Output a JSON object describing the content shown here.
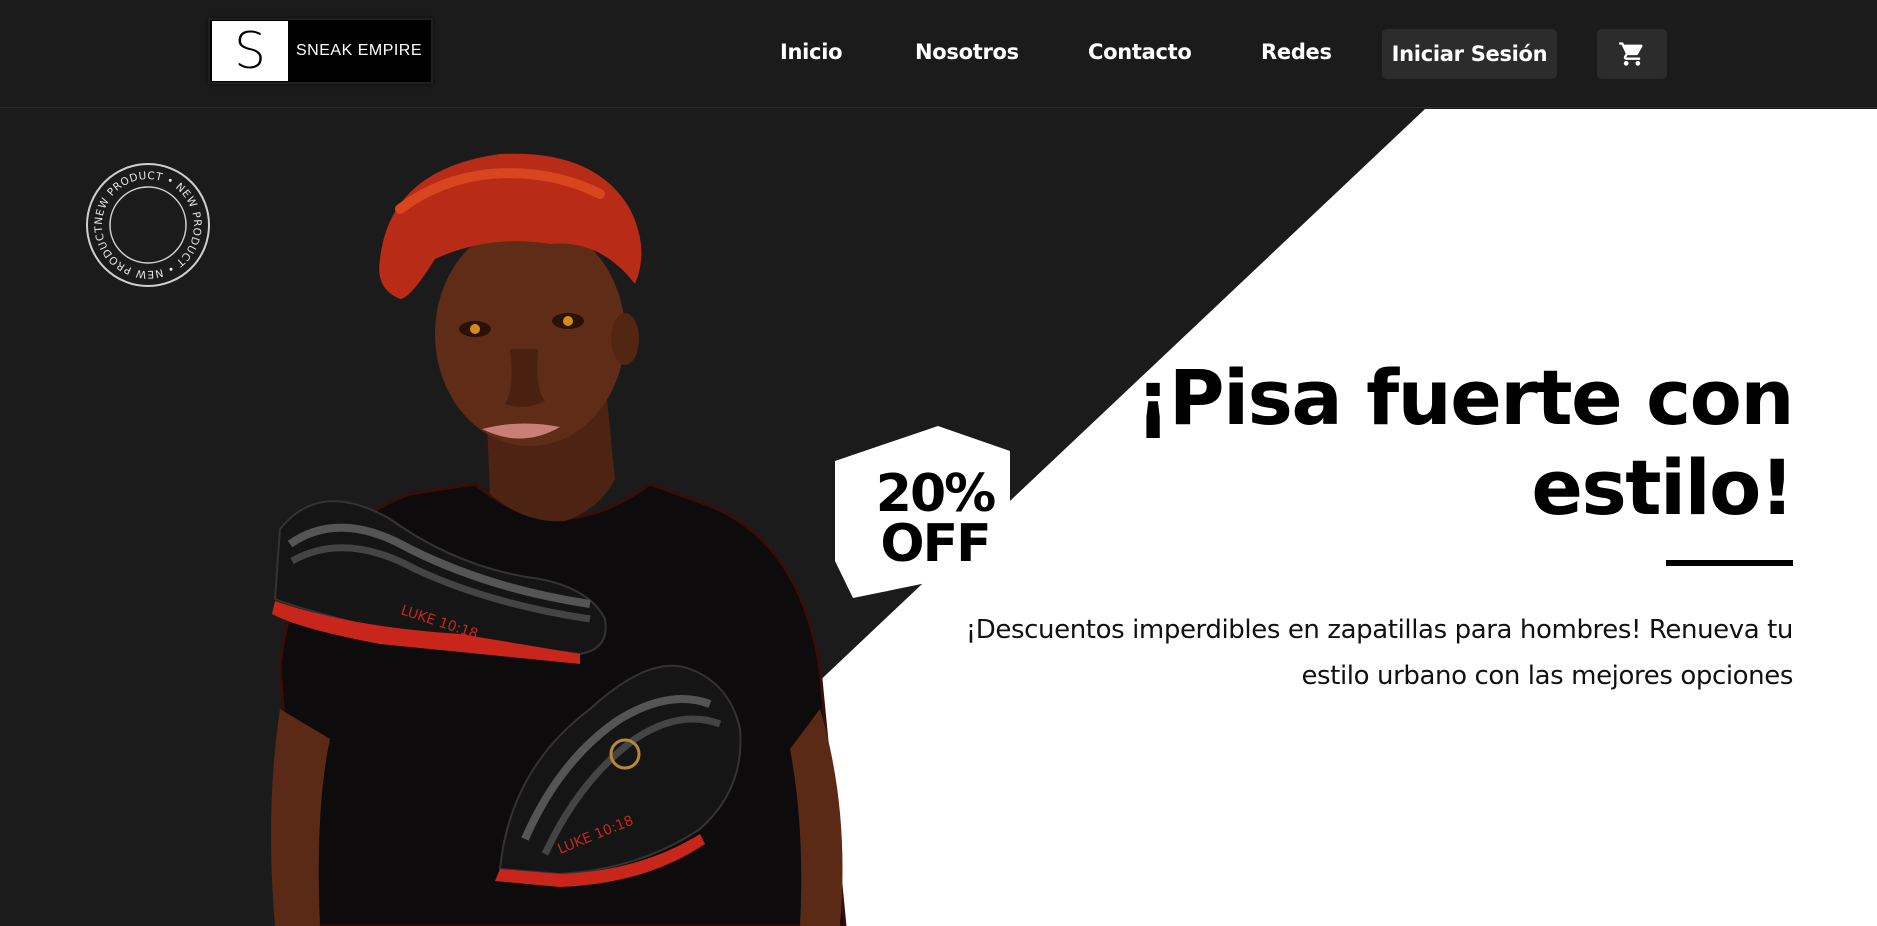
{
  "brand": {
    "logo_letter": "S",
    "name": "SNEAK EMPIRE"
  },
  "nav": {
    "items": [
      {
        "label": "Inicio"
      },
      {
        "label": "Nosotros"
      },
      {
        "label": "Contacto"
      },
      {
        "label": "Redes"
      }
    ],
    "login_label": "Iniciar Sesión",
    "cart_icon": "cart-icon"
  },
  "hero": {
    "badge_text": "NEW PRODUCT • NEW PRODUCT • NEW PRODUCT • ",
    "discount_line1": "20%",
    "discount_line2": "OFF",
    "headline_line1": "¡Pisa fuerte con",
    "headline_line2": "estilo!",
    "subtext_line1": "¡Descuentos imperdibles en zapatillas para hombres! Renueva tu",
    "subtext_line2": "estilo urbano con las mejores opciones",
    "shoe_text": "LUKE 10:18",
    "colors": {
      "dark_bg": "#1b1b1b",
      "light_bg": "#ffffff",
      "accent_red": "#c8261b"
    }
  }
}
